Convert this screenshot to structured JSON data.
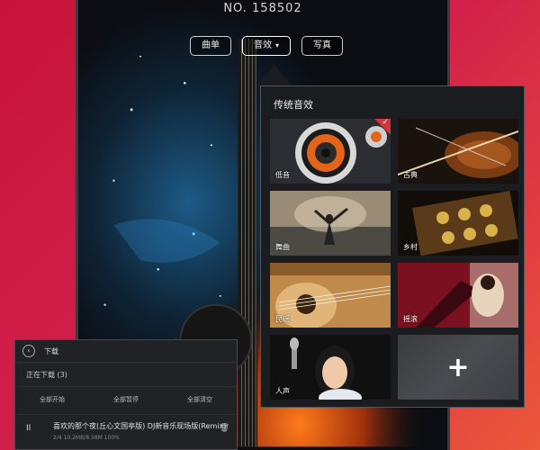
{
  "device": {
    "number": "NO. 158502"
  },
  "tabs": [
    {
      "label": "曲单",
      "active": false,
      "caret": ""
    },
    {
      "label": "音效",
      "active": true,
      "caret": "▾"
    },
    {
      "label": "写真",
      "active": false,
      "caret": ""
    }
  ],
  "effects_panel": {
    "title": "传统音效",
    "items": [
      {
        "label": "低音",
        "selected": true
      },
      {
        "label": "古典",
        "selected": false
      },
      {
        "label": "舞曲",
        "selected": false
      },
      {
        "label": "乡村",
        "selected": false
      },
      {
        "label": "民谣",
        "selected": false
      },
      {
        "label": "摇滚",
        "selected": false
      },
      {
        "label": "人声",
        "selected": false
      }
    ],
    "add_label": "+",
    "check_mark": "✓"
  },
  "download_panel": {
    "back_icon": "‹",
    "title": "下载",
    "subtitle": "正在下载 (3)",
    "columns": [
      "全部开始",
      "全部暂停",
      "全部清空"
    ],
    "item": {
      "pause_icon": "II",
      "name": "喜欢的那个夜(丘心文国亭版) DJ新音乐现场版(Remix)",
      "meta": "2/4   10.2MB/8.58M   100%",
      "trash_icon": "🗑"
    }
  },
  "colors": {
    "background": "#c8143c",
    "accent": "#d6343a",
    "panel": "#1a1c20"
  }
}
